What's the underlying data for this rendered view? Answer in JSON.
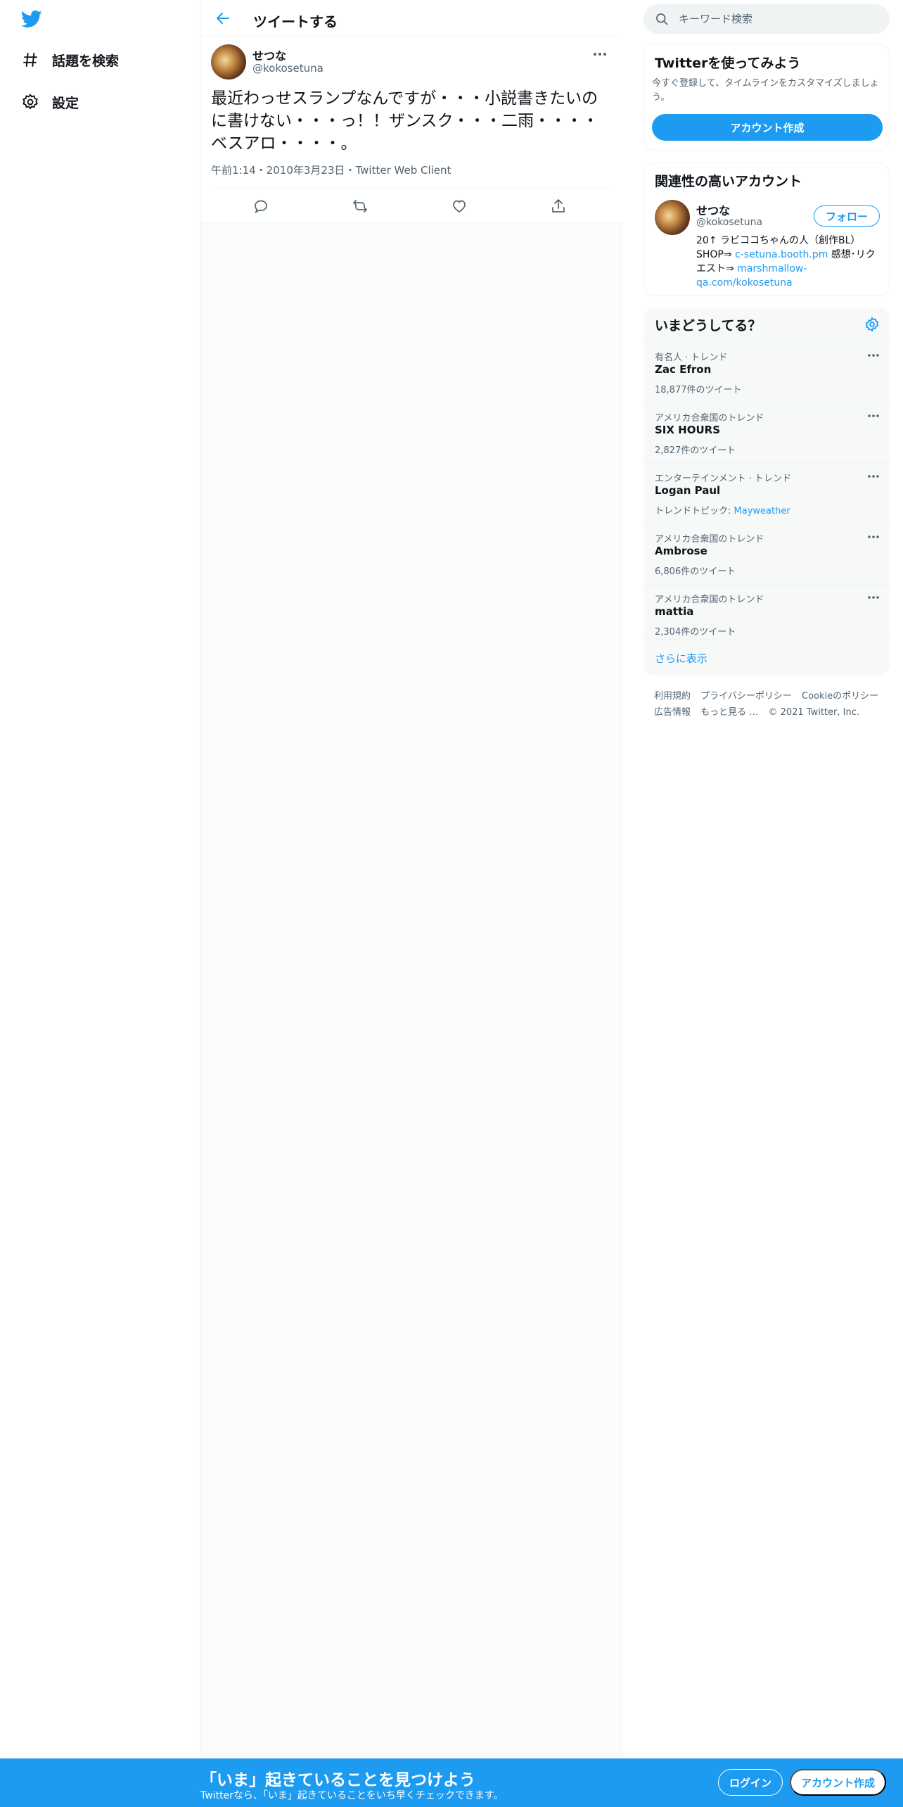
{
  "colors": {
    "brand": "#1d9bf0",
    "text": "#0f1419",
    "muted": "#536471"
  },
  "nav": {
    "logo_icon": "twitter-bird-icon",
    "items": [
      {
        "label": "話題を検索",
        "icon": "hashtag-icon"
      },
      {
        "label": "設定",
        "icon": "gear-icon"
      }
    ]
  },
  "header": {
    "title": "ツイートする",
    "back_icon": "back-arrow-icon"
  },
  "tweet": {
    "author_name": "せつな",
    "author_handle": "@kokosetuna",
    "text": "最近わっせスランプなんですが・・・小説書きたいのに書けない・・・っ！！ザンスク・・・二雨・・・・ベスアロ・・・・。",
    "meta": "午前1:14・2010年3月23日・Twitter Web Client",
    "actions": [
      "reply-icon",
      "retweet-icon",
      "like-icon",
      "share-icon"
    ]
  },
  "search": {
    "placeholder": "キーワード検索"
  },
  "signup_card": {
    "title": "Twitterを使ってみよう",
    "desc": "今すぐ登録して、タイムラインをカスタマイズしましょう。",
    "button": "アカウント作成"
  },
  "related": {
    "title": "関連性の高いアカウント",
    "name": "せつな",
    "handle": "@kokosetuna",
    "follow": "フォロー",
    "bio_1": "20↑ ラビココちゃんの人（創作BL）SHOP⇒ ",
    "bio_link_1": "c-setuna.booth.pm",
    "bio_2": " 感想･リクエスト⇒ ",
    "bio_link_2": "marshmallow-qa.com/kokosetuna"
  },
  "trends": {
    "title": "いまどうしてる？",
    "items": [
      {
        "category": "有名人 · トレンド",
        "name": "Zac Efron",
        "count": "18,877件のツイート"
      },
      {
        "category": "アメリカ合衆国のトレンド",
        "name": "SIX HOURS",
        "count": "2,827件のツイート"
      },
      {
        "category": "エンターテインメント · トレンド",
        "name": "Logan Paul",
        "count_prefix": "トレンドトピック: ",
        "count_link": "Mayweather"
      },
      {
        "category": "アメリカ合衆国のトレンド",
        "name": "Ambrose",
        "count": "6,806件のツイート"
      },
      {
        "category": "アメリカ合衆国のトレンド",
        "name": "mattia",
        "count": "2,304件のツイート"
      }
    ],
    "show_more": "さらに表示"
  },
  "footer": {
    "links": [
      "利用規約",
      "プライバシーポリシー",
      "Cookieのポリシー",
      "広告情報",
      "もっと見る …",
      "© 2021 Twitter, Inc."
    ]
  },
  "bottom_bar": {
    "title": "「いま」起きていることを見つけよう",
    "subtitle": "Twitterなら、「いま」起きていることをいち早くチェックできます。",
    "login": "ログイン",
    "signup": "アカウント作成"
  }
}
